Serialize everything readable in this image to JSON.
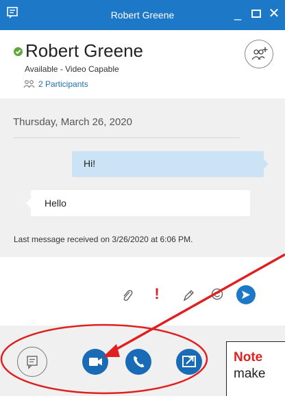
{
  "window": {
    "title": "Robert Greene",
    "title_color": "#1e78c8",
    "controls": {
      "minimize_glyph": "_",
      "close_glyph": "✕"
    }
  },
  "contact": {
    "name": "Robert Greene",
    "status": "Available - Video Capable",
    "status_color": "#5fa73c",
    "participants_label": "2 Participants"
  },
  "conversation": {
    "date": "Thursday, March 26, 2020",
    "messages": [
      {
        "direction": "outgoing",
        "text": "Hi!"
      },
      {
        "direction": "incoming",
        "text": "Hello"
      }
    ],
    "last_message_info": "Last message received on 3/26/2020 at 6:06 PM."
  },
  "compose": {
    "icons": [
      "paperclip-icon",
      "exclamation-icon",
      "pen-icon",
      "emoji-icon",
      "send-icon"
    ],
    "important_glyph": "!"
  },
  "bottom_bar": {
    "buttons": [
      "im-icon",
      "video-camera-icon",
      "phone-icon",
      "present-screen-icon"
    ],
    "accent_color": "#1a6bb5"
  },
  "annotation": {
    "note_title": "Note",
    "note_text": "make",
    "ellipse_color": "#e02020",
    "arrow_color": "#e02020"
  }
}
